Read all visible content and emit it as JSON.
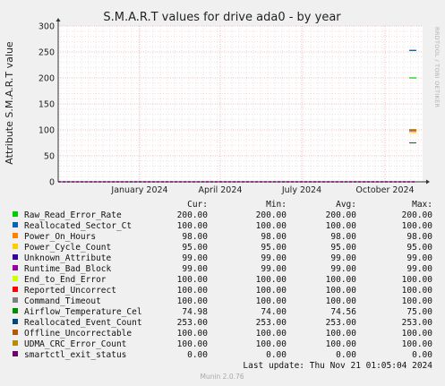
{
  "chart_data": {
    "type": "line",
    "title": "S.M.A.R.T values for drive ada0 - by year",
    "ylabel": "Attribute S.M.A.R.T value",
    "ylim": [
      0,
      300
    ],
    "yticks": [
      0,
      50,
      100,
      150,
      200,
      250,
      300
    ],
    "xticks": [
      "January 2024",
      "April 2024",
      "July 2024",
      "October 2024"
    ],
    "grid": true,
    "columns": [
      "Cur:",
      "Min:",
      "Avg:",
      "Max:"
    ],
    "series": [
      {
        "name": "Raw_Read_Error_Rate",
        "color": "#00cc00",
        "cur": "200.00",
        "min": "200.00",
        "avg": "200.00",
        "max": "200.00"
      },
      {
        "name": "Reallocated_Sector_Ct",
        "color": "#0066b3",
        "cur": "100.00",
        "min": "100.00",
        "avg": "100.00",
        "max": "100.00"
      },
      {
        "name": "Power_On_Hours",
        "color": "#ff8000",
        "cur": "98.00",
        "min": "98.00",
        "avg": "98.00",
        "max": "98.00"
      },
      {
        "name": "Power_Cycle_Count",
        "color": "#ffcc00",
        "cur": "95.00",
        "min": "95.00",
        "avg": "95.00",
        "max": "95.00"
      },
      {
        "name": "Unknown_Attribute",
        "color": "#330099",
        "cur": "99.00",
        "min": "99.00",
        "avg": "99.00",
        "max": "99.00"
      },
      {
        "name": "Runtime_Bad_Block",
        "color": "#990099",
        "cur": "99.00",
        "min": "99.00",
        "avg": "99.00",
        "max": "99.00"
      },
      {
        "name": "End_to_End_Error",
        "color": "#ccff00",
        "cur": "100.00",
        "min": "100.00",
        "avg": "100.00",
        "max": "100.00"
      },
      {
        "name": "Reported_Uncorrect",
        "color": "#ff0000",
        "cur": "100.00",
        "min": "100.00",
        "avg": "100.00",
        "max": "100.00"
      },
      {
        "name": "Command_Timeout",
        "color": "#808080",
        "cur": "100.00",
        "min": "100.00",
        "avg": "100.00",
        "max": "100.00"
      },
      {
        "name": "Airflow_Temperature_Cel",
        "color": "#008f00",
        "cur": "74.98",
        "min": "74.00",
        "avg": "74.56",
        "max": "75.00"
      },
      {
        "name": "Reallocated_Event_Count",
        "color": "#00487d",
        "cur": "253.00",
        "min": "253.00",
        "avg": "253.00",
        "max": "253.00"
      },
      {
        "name": "Offline_Uncorrectable",
        "color": "#b35a00",
        "cur": "100.00",
        "min": "100.00",
        "avg": "100.00",
        "max": "100.00"
      },
      {
        "name": "UDMA_CRC_Error_Count",
        "color": "#b38f00",
        "cur": "100.00",
        "min": "100.00",
        "avg": "100.00",
        "max": "100.00"
      },
      {
        "name": "smartctl_exit_status",
        "color": "#6b006b",
        "cur": "0.00",
        "min": "0.00",
        "avg": "0.00",
        "max": "0.00"
      }
    ]
  },
  "side_label": "RRDTOOL / TOBI OETIKER",
  "last_update": "Last update:  Thu Nov 21 01:05:04 2024",
  "footer": "Munin 2.0.76"
}
